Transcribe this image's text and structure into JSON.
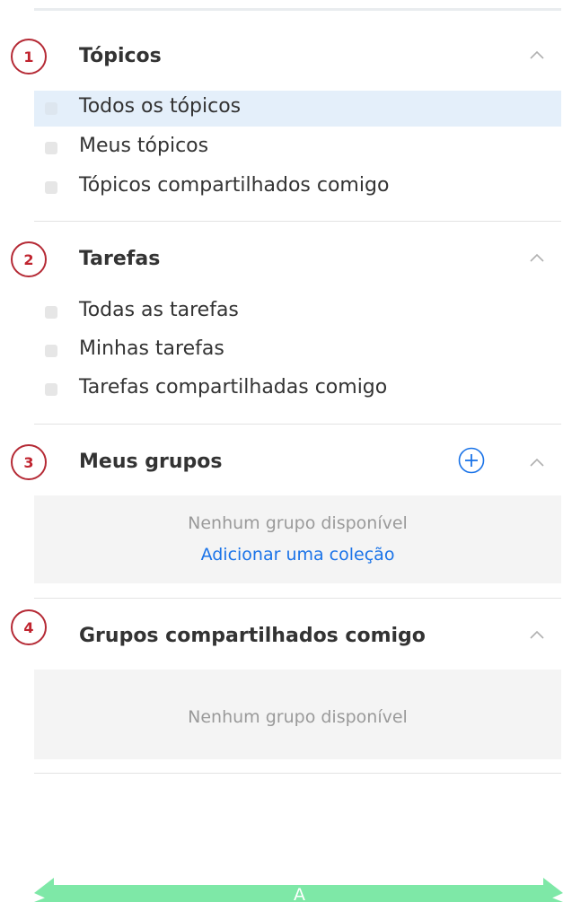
{
  "sections": [
    {
      "number": "1",
      "title": "Tópicos",
      "items": [
        {
          "label": "Todos os tópicos",
          "active": true
        },
        {
          "label": "Meus tópicos",
          "active": false
        },
        {
          "label": "Tópicos compartilhados comigo",
          "active": false
        }
      ]
    },
    {
      "number": "2",
      "title": "Tarefas",
      "items": [
        {
          "label": "Todas as tarefas",
          "active": false
        },
        {
          "label": "Minhas tarefas",
          "active": false
        },
        {
          "label": "Tarefas compartilhadas comigo",
          "active": false
        }
      ]
    },
    {
      "number": "3",
      "title": "Meus grupos",
      "empty_text": "Nenhum grupo disponível",
      "link_text": "Adicionar uma coleção"
    },
    {
      "number": "4",
      "title": "Grupos compartilhados comigo",
      "empty_text": "Nenhum grupo disponível"
    }
  ],
  "footer": {
    "width_label": "A"
  },
  "colors": {
    "callout": "#c0242f",
    "link": "#1a73e8",
    "active_row": "#e4effa",
    "width_arrow": "#7ee8a7"
  }
}
